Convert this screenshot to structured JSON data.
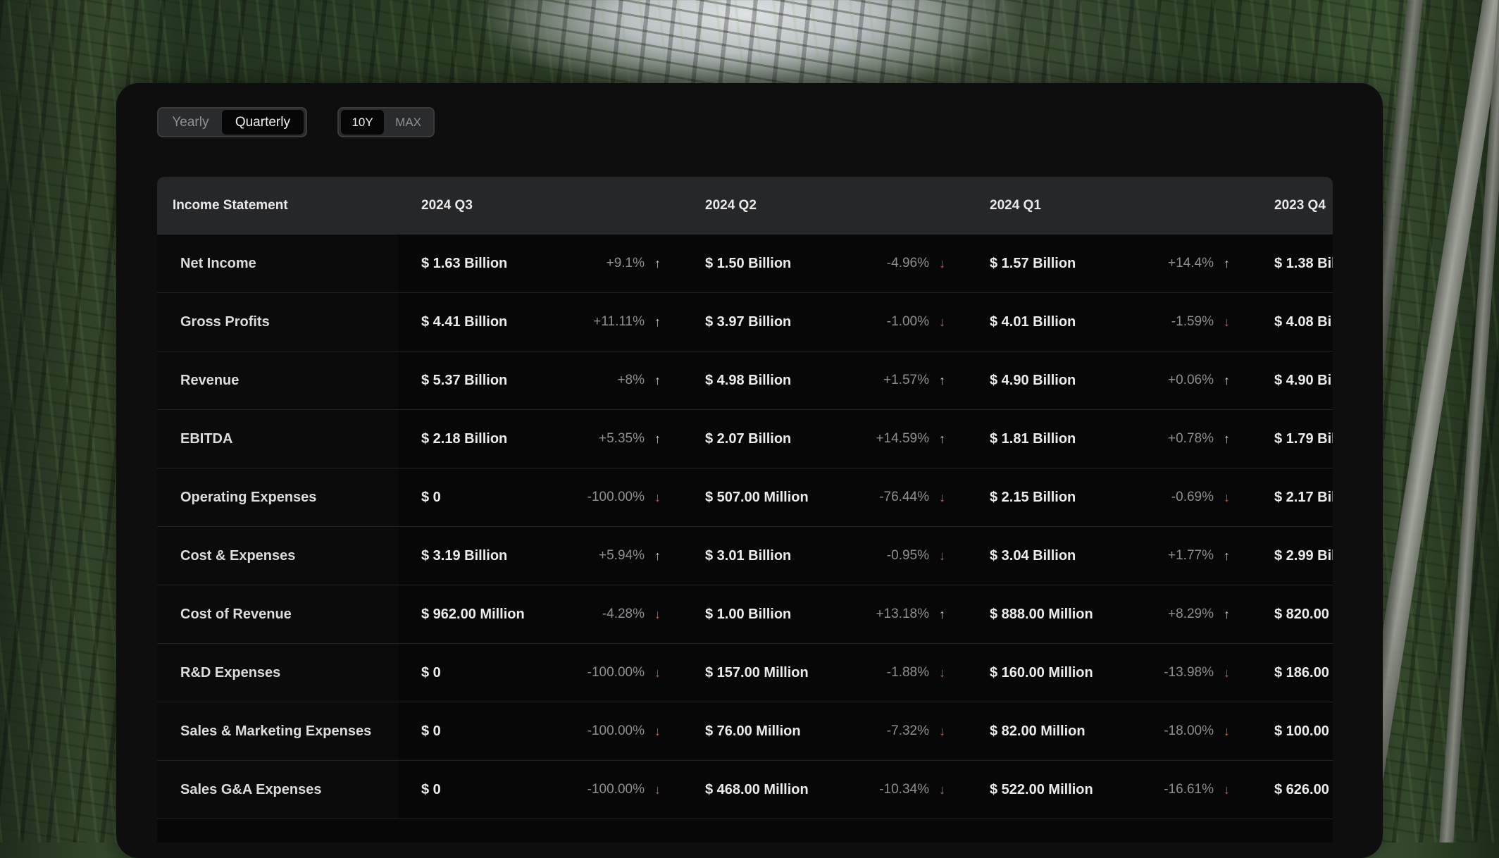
{
  "toggles": {
    "period": [
      {
        "label": "Yearly",
        "active": false
      },
      {
        "label": "Quarterly",
        "active": true
      }
    ],
    "range": [
      {
        "label": "10Y",
        "active": true
      },
      {
        "label": "MAX",
        "active": false
      }
    ]
  },
  "table": {
    "title": "Income Statement",
    "columns": [
      "2024 Q3",
      "2024 Q2",
      "2024 Q1",
      "2023 Q4"
    ],
    "rows": [
      {
        "label": "Net Income",
        "cells": [
          {
            "value": "$ 1.63 Billion",
            "change": "+9.1%",
            "dir": "up"
          },
          {
            "value": "$ 1.50 Billion",
            "change": "-4.96%",
            "dir": "down"
          },
          {
            "value": "$ 1.57 Billion",
            "change": "+14.4%",
            "dir": "up"
          },
          {
            "value": "$ 1.38 Bil"
          }
        ]
      },
      {
        "label": "Gross Profits",
        "cells": [
          {
            "value": "$ 4.41 Billion",
            "change": "+11.11%",
            "dir": "up"
          },
          {
            "value": "$ 3.97 Billion",
            "change": "-1.00%",
            "dir": "down"
          },
          {
            "value": "$ 4.01 Billion",
            "change": "-1.59%",
            "dir": "down"
          },
          {
            "value": "$ 4.08 Bi"
          }
        ]
      },
      {
        "label": "Revenue",
        "cells": [
          {
            "value": "$ 5.37 Billion",
            "change": "+8%",
            "dir": "up"
          },
          {
            "value": "$ 4.98 Billion",
            "change": "+1.57%",
            "dir": "up"
          },
          {
            "value": "$ 4.90 Billion",
            "change": "+0.06%",
            "dir": "up"
          },
          {
            "value": "$ 4.90 Bi"
          }
        ]
      },
      {
        "label": "EBITDA",
        "cells": [
          {
            "value": "$ 2.18 Billion",
            "change": "+5.35%",
            "dir": "up"
          },
          {
            "value": "$ 2.07 Billion",
            "change": "+14.59%",
            "dir": "up"
          },
          {
            "value": "$ 1.81 Billion",
            "change": "+0.78%",
            "dir": "up"
          },
          {
            "value": "$ 1.79 Bil"
          }
        ]
      },
      {
        "label": "Operating Expenses",
        "cells": [
          {
            "value": "$ 0",
            "change": "-100.00%",
            "dir": "down"
          },
          {
            "value": "$ 507.00 Million",
            "change": "-76.44%",
            "dir": "down"
          },
          {
            "value": "$ 2.15 Billion",
            "change": "-0.69%",
            "dir": "down"
          },
          {
            "value": "$ 2.17 Bil"
          }
        ]
      },
      {
        "label": "Cost & Expenses",
        "cells": [
          {
            "value": "$ 3.19 Billion",
            "change": "+5.94%",
            "dir": "up"
          },
          {
            "value": "$ 3.01 Billion",
            "change": "-0.95%",
            "dir": "down"
          },
          {
            "value": "$ 3.04 Billion",
            "change": "+1.77%",
            "dir": "up"
          },
          {
            "value": "$ 2.99 Bil"
          }
        ]
      },
      {
        "label": "Cost of Revenue",
        "cells": [
          {
            "value": "$ 962.00 Million",
            "change": "-4.28%",
            "dir": "down"
          },
          {
            "value": "$ 1.00 Billion",
            "change": "+13.18%",
            "dir": "up"
          },
          {
            "value": "$ 888.00 Million",
            "change": "+8.29%",
            "dir": "up"
          },
          {
            "value": "$ 820.00"
          }
        ]
      },
      {
        "label": "R&D Expenses",
        "cells": [
          {
            "value": "$ 0",
            "change": "-100.00%",
            "dir": "down"
          },
          {
            "value": "$ 157.00 Million",
            "change": "-1.88%",
            "dir": "down"
          },
          {
            "value": "$ 160.00 Million",
            "change": "-13.98%",
            "dir": "down"
          },
          {
            "value": "$ 186.00"
          }
        ]
      },
      {
        "label": "Sales & Marketing Expenses",
        "cells": [
          {
            "value": "$ 0",
            "change": "-100.00%",
            "dir": "down"
          },
          {
            "value": "$ 76.00 Million",
            "change": "-7.32%",
            "dir": "down"
          },
          {
            "value": "$ 82.00 Million",
            "change": "-18.00%",
            "dir": "down"
          },
          {
            "value": "$ 100.00"
          }
        ]
      },
      {
        "label": "Sales G&A Expenses",
        "cells": [
          {
            "value": "$ 0",
            "change": "-100.00%",
            "dir": "down"
          },
          {
            "value": "$ 468.00 Million",
            "change": "-10.34%",
            "dir": "down"
          },
          {
            "value": "$ 522.00 Million",
            "change": "-16.61%",
            "dir": "down"
          },
          {
            "value": "$ 626.00"
          }
        ]
      }
    ]
  },
  "icons": {
    "up": "arrow-up-icon",
    "down": "arrow-down-icon"
  },
  "colors": {
    "panel": "#0e0e0f",
    "header": "#262729",
    "negative": "#e0524c"
  }
}
